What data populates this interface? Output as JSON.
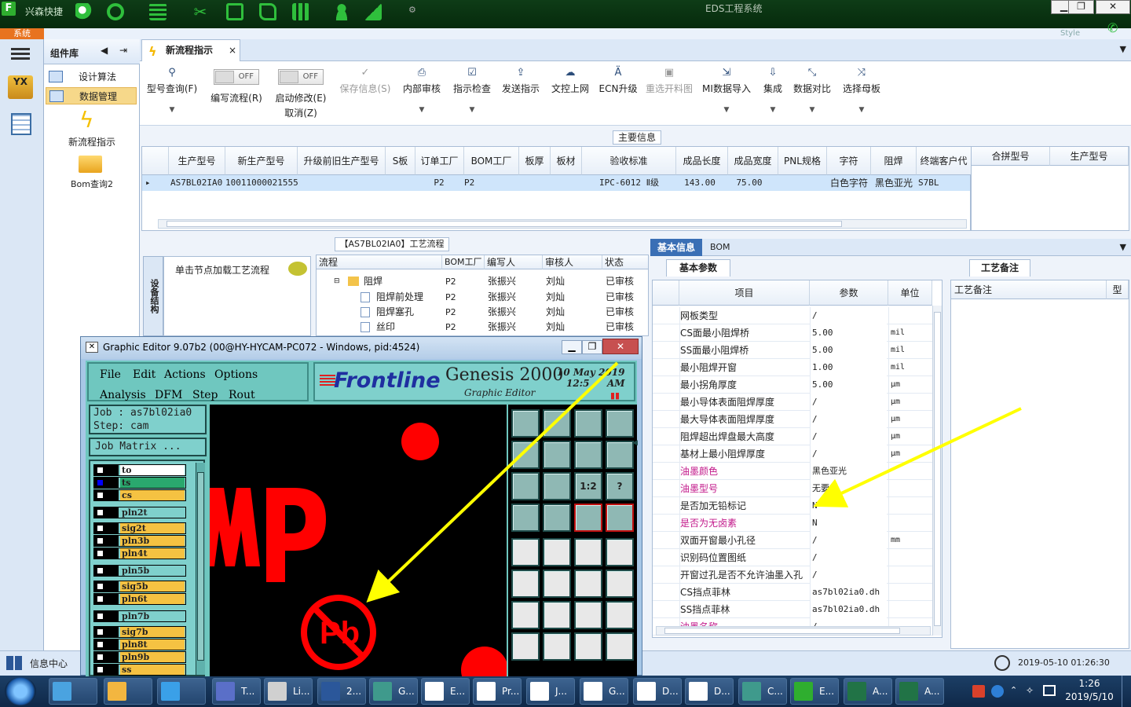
{
  "colors": {
    "accent": "#3a6fb5",
    "magenta": "#c2188a",
    "arrow": "#ffff00",
    "pcb_red": "#ff0000"
  },
  "titlebar": {
    "quick_label": "兴森快捷",
    "title": "EDS工程系统",
    "style_label": "Style",
    "system_tab": "系统",
    "win_min": "▁",
    "win_restore": "❐",
    "win_close": "✕"
  },
  "components": {
    "title": "组件库",
    "items": [
      {
        "label": "设计算法"
      },
      {
        "label": "数据管理"
      }
    ],
    "new_flow": "新流程指示",
    "bom_query": "Bom查询2"
  },
  "doc_tab": {
    "label": "新流程指示",
    "close": "×"
  },
  "ribbon": {
    "buttons": [
      {
        "label": "型号查询(F)",
        "icon": "search-icon",
        "enabled": true
      },
      {
        "label": "编写流程(R)",
        "icon": "toggle",
        "enabled": true
      },
      {
        "label": "启动修改(E)",
        "sub": "取消(Z)",
        "icon": "toggle",
        "enabled": true
      },
      {
        "label": "保存信息(S)",
        "icon": "check-icon",
        "enabled": false
      },
      {
        "label": "内部审核",
        "icon": "printer-icon",
        "enabled": true
      },
      {
        "label": "指示检查",
        "icon": "check-box-icon",
        "enabled": true
      },
      {
        "label": "发送指示",
        "icon": "upload-icon",
        "enabled": true
      },
      {
        "label": "文控上网",
        "icon": "cloud-upload-icon",
        "enabled": true
      },
      {
        "label": "ECN升级",
        "icon": "ecn-icon",
        "enabled": true
      },
      {
        "label": "重选开料图",
        "icon": "image-icon",
        "enabled": false
      },
      {
        "label": "MI数据导入",
        "icon": "import-icon",
        "enabled": true
      },
      {
        "label": "集成",
        "icon": "download-icon",
        "enabled": true
      },
      {
        "label": "数据对比",
        "icon": "compare-icon",
        "enabled": true
      },
      {
        "label": "选择母板",
        "icon": "shuffle-icon",
        "enabled": true
      }
    ],
    "toggle_off": "OFF"
  },
  "main_info": {
    "title": "主要信息",
    "columns": [
      "生产型号",
      "新生产型号",
      "升级前旧生产型号",
      "S板",
      "订单工厂",
      "BOM工厂",
      "板厚",
      "板材",
      "验收标准",
      "成品长度",
      "成品宽度",
      "PNL规格",
      "字符",
      "阻焊",
      "终端客户代"
    ],
    "row": [
      "AS7BL02IA0",
      "10011000021555",
      "",
      "",
      "P2",
      "P2",
      "",
      "",
      "IPC-6012 Ⅱ级",
      "143.00",
      "75.00",
      "",
      "白色字符",
      "黑色亚光",
      "S7BL"
    ],
    "right_columns": [
      "合拼型号",
      "生产型号"
    ]
  },
  "flow": {
    "title": "【AS7BL02IA0】工艺流程",
    "side_tab": "设备结构",
    "click_hint": "单击节点加载工艺流程",
    "columns": [
      "流程",
      "BOM工厂",
      "编写人",
      "审核人",
      "状态"
    ],
    "rows": [
      {
        "name": "阻焊",
        "bom": "P2",
        "writer": "张振兴",
        "reviewer": "刘灿",
        "status": "已审核",
        "level": 0
      },
      {
        "name": "阻焊前处理",
        "bom": "P2",
        "writer": "张振兴",
        "reviewer": "刘灿",
        "status": "已审核",
        "level": 1
      },
      {
        "name": "阻焊塞孔",
        "bom": "P2",
        "writer": "张振兴",
        "reviewer": "刘灿",
        "status": "已审核",
        "level": 1
      },
      {
        "name": "丝印",
        "bom": "P2",
        "writer": "张振兴",
        "reviewer": "刘灿",
        "status": "已审核",
        "level": 1
      }
    ]
  },
  "basic_info": {
    "tabs": [
      "基本信息",
      "BOM"
    ],
    "param_tab": "基本参数",
    "columns": [
      "项目",
      "参数",
      "单位"
    ],
    "rows": [
      {
        "item": "网板类型",
        "value": "/",
        "unit": "",
        "mag": false
      },
      {
        "item": "CS面最小阻焊桥",
        "value": "5.00",
        "unit": "mil",
        "mag": false
      },
      {
        "item": "SS面最小阻焊桥",
        "value": "5.00",
        "unit": "mil",
        "mag": false
      },
      {
        "item": "最小阻焊开窗",
        "value": "1.00",
        "unit": "mil",
        "mag": false
      },
      {
        "item": "最小拐角厚度",
        "value": "5.00",
        "unit": "μm",
        "mag": false
      },
      {
        "item": "最小导体表面阻焊厚度",
        "value": "/",
        "unit": "μm",
        "mag": false
      },
      {
        "item": "最大导体表面阻焊厚度",
        "value": "/",
        "unit": "μm",
        "mag": false
      },
      {
        "item": "阻焊超出焊盘最大高度",
        "value": "/",
        "unit": "μm",
        "mag": false
      },
      {
        "item": "基材上最小阻焊厚度",
        "value": "/",
        "unit": "μm",
        "mag": false
      },
      {
        "item": "油墨颜色",
        "value": "黑色亚光",
        "unit": "",
        "mag": true
      },
      {
        "item": "油墨型号",
        "value": "无要求",
        "unit": "",
        "mag": true
      },
      {
        "item": "是否加无铅标记",
        "value": "N",
        "unit": "",
        "mag": false
      },
      {
        "item": "是否为无卤素",
        "value": "N",
        "unit": "",
        "mag": true
      },
      {
        "item": "双面开窗最小孔径",
        "value": "/",
        "unit": "mm",
        "mag": false
      },
      {
        "item": "识别码位置图纸",
        "value": "/",
        "unit": "",
        "mag": false
      },
      {
        "item": "开窗过孔是否不允许油墨入孔",
        "value": "/",
        "unit": "",
        "mag": false
      },
      {
        "item": "CS挡点菲林",
        "value": "as7bl02ia0.dh",
        "unit": "",
        "mag": false
      },
      {
        "item": "SS挡点菲林",
        "value": "as7bl02ia0.dh",
        "unit": "",
        "mag": false
      },
      {
        "item": "油墨名称",
        "value": "/",
        "unit": "",
        "mag": true
      }
    ],
    "remark_tab": "工艺备注",
    "remark_header": "工艺备注",
    "remark_header2": "型"
  },
  "statusbar": {
    "info_center": "信息中心",
    "datetime": "2019-05-10 01:26:30"
  },
  "taskbar": {
    "items": [
      {
        "label": "",
        "icon": "start-orb"
      },
      {
        "label": "",
        "icon": "pin-app"
      },
      {
        "label": "",
        "icon": "shell-app"
      },
      {
        "label": "",
        "icon": "ie-icon"
      },
      {
        "label": "T...",
        "icon": "save-app"
      },
      {
        "label": "Li...",
        "icon": "doc-app"
      },
      {
        "label": "2...",
        "icon": "word-icon"
      },
      {
        "label": "G...",
        "icon": "eye-app"
      },
      {
        "label": "E...",
        "icon": "x-app"
      },
      {
        "label": "Pr...",
        "icon": "x-app"
      },
      {
        "label": "J...",
        "icon": "x-app"
      },
      {
        "label": "G...",
        "icon": "x-app"
      },
      {
        "label": "D...",
        "icon": "x-app"
      },
      {
        "label": "D...",
        "icon": "x-app"
      },
      {
        "label": "C...",
        "icon": "eye-app"
      },
      {
        "label": "E...",
        "icon": "f-app"
      },
      {
        "label": "A...",
        "icon": "excel-icon"
      },
      {
        "label": "A...",
        "icon": "excel-icon"
      }
    ],
    "clock_time": "1:26",
    "clock_date": "2019/5/10"
  },
  "genesis": {
    "title": "Graphic Editor 9.07b2 (00@HY-HYCAM-PC072 - Windows, pid:4524)",
    "menu": [
      "File",
      "Edit",
      "Actions",
      "Options",
      "Analysis",
      "DFM",
      "Step",
      "Rout"
    ],
    "brand": "Frontline",
    "product": "Genesis 2000",
    "subtitle": "Graphic Editor",
    "date": "10 May 2019",
    "time": "12:5",
    "ampm": "AM",
    "job": "Job : as7bl02ia0",
    "step": "Step: cam",
    "job_matrix": "Job Matrix ...",
    "layers": [
      {
        "name": "to",
        "color": "#ffffff",
        "checked": false
      },
      {
        "name": "ts",
        "color": "#2aa86e",
        "checked": true
      },
      {
        "name": "cs",
        "color": "#f5c242",
        "checked": false
      },
      {
        "name": "pln2t",
        "color": "#7fd0cc",
        "checked": false
      },
      {
        "name": "sig2t",
        "color": "#f5c242",
        "checked": false
      },
      {
        "name": "pln3b",
        "color": "#f5c242",
        "checked": false
      },
      {
        "name": "pln4t",
        "color": "#f5c242",
        "checked": false
      },
      {
        "name": "pln5b",
        "color": "#7fd0cc",
        "checked": false
      },
      {
        "name": "sig5b",
        "color": "#f5c242",
        "checked": false
      },
      {
        "name": "pln6t",
        "color": "#f5c242",
        "checked": false
      },
      {
        "name": "pln7b",
        "color": "#7fd0cc",
        "checked": false
      },
      {
        "name": "sig7b",
        "color": "#f5c242",
        "checked": false
      },
      {
        "name": "pln8t",
        "color": "#f5c242",
        "checked": false
      },
      {
        "name": "pln9b",
        "color": "#f5c242",
        "checked": false
      },
      {
        "name": "ss",
        "color": "#f5c242",
        "checked": false
      }
    ],
    "canvas_text": "Pb",
    "ratio_btn": "1:2",
    "help_btn": "?"
  }
}
